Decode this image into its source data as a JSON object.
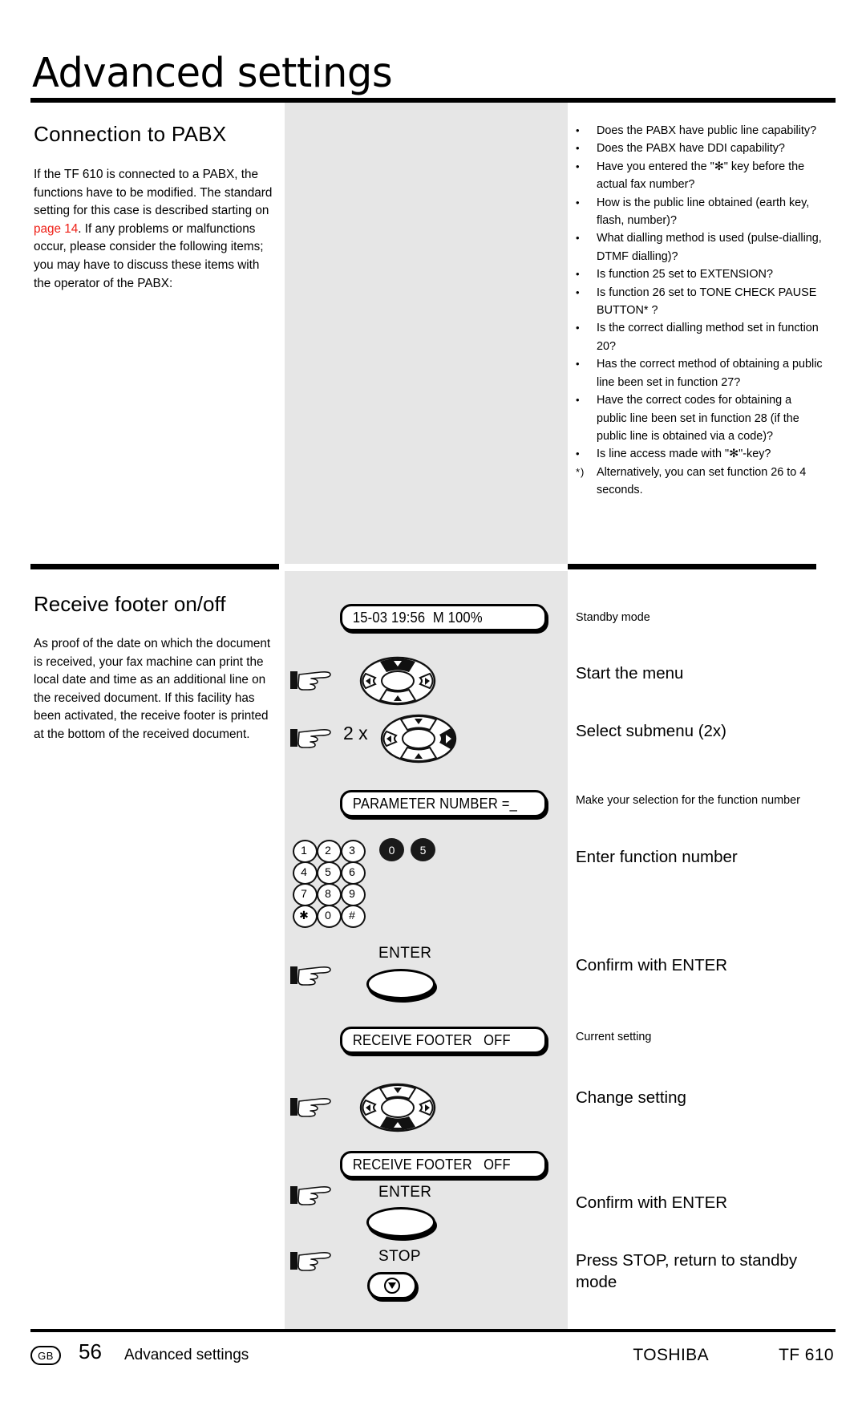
{
  "header": {
    "title": "Advanced settings"
  },
  "section1": {
    "heading": "Connection to PABX",
    "body_before_link": "If the TF 610 is connected to a PABX, the functions have to be modified. The standard setting for this case is described starting on ",
    "link_text": "page 14",
    "body_after_link": ". If any problems or malfunctions occur, please consider the following items; you may have to discuss these items with the operator of the PABX:",
    "bullets": [
      "Does the PABX have public line capability?",
      "Does the PABX have DDI capability?",
      "Have you entered the \"✻\" key before the actual fax number?",
      "How is the public line obtained (earth key, flash, number)?",
      "What dialling method is used (pulse-dialling, DTMF dialling)?",
      "Is function 25 set to EXTENSION?",
      "Is function 26 set to TONE CHECK PAUSE BUTTON* ?",
      "Is the correct dialling method set in function 20?",
      "Has the correct method of obtaining a public line been set in function 27?",
      "Have the correct codes for obtaining a public line been set in function 28 (if the public line is obtained via a code)?",
      "Is line access made with \"✻\"-key?"
    ],
    "footnote_mark": "*)",
    "footnote_text": "Alternatively, you can set function 26 to 4 seconds."
  },
  "section2": {
    "heading": "Receive footer on/off",
    "body": "As proof of the date on which the document is received, your fax machine can print the local date and time as an additional line on the received document. If this facility has been activated, the receive footer is printed at the bottom of the received document.",
    "steps": [
      {
        "display": "15-03 19:56  M 100%",
        "label": "Standby mode",
        "size": "small"
      },
      {
        "label": "Start the menu",
        "size": "big"
      },
      {
        "repeat": "2 x",
        "label": "Select submenu (2x)",
        "size": "big"
      },
      {
        "display": "PARAMETER NUMBER =_",
        "label": "Make your selection for the function number",
        "size": "small"
      },
      {
        "label": "Enter function number",
        "size": "big"
      },
      {
        "button": "ENTER",
        "label": "Confirm with ENTER",
        "size": "big"
      },
      {
        "display": "RECEIVE FOOTER   OFF",
        "label": "Current setting",
        "size": "small"
      },
      {
        "label": "Change setting",
        "size": "big"
      },
      {
        "display": "RECEIVE FOOTER   OFF",
        "label": "",
        "size": "small"
      },
      {
        "button": "ENTER",
        "label": "Confirm with ENTER",
        "size": "big"
      },
      {
        "button": "STOP",
        "label": "Press STOP, return to standby mode",
        "size": "big"
      }
    ],
    "keypad": {
      "keys": [
        "1",
        "2",
        "3",
        "4",
        "5",
        "6",
        "7",
        "8",
        "9",
        "✱",
        "0",
        "#"
      ],
      "highlighted": [
        "0",
        "5"
      ]
    },
    "button_labels": {
      "enter": "ENTER",
      "stop": "STOP"
    },
    "repeat_label": "2 x"
  },
  "footer": {
    "region": "GB",
    "page_number": "56",
    "section_name": "Advanced settings",
    "brand": "TOSHIBA",
    "model": "TF 610"
  },
  "colors": {
    "link_red": "#ef2017",
    "panel_gray": "#e6e6e6",
    "ink": "#000000"
  }
}
